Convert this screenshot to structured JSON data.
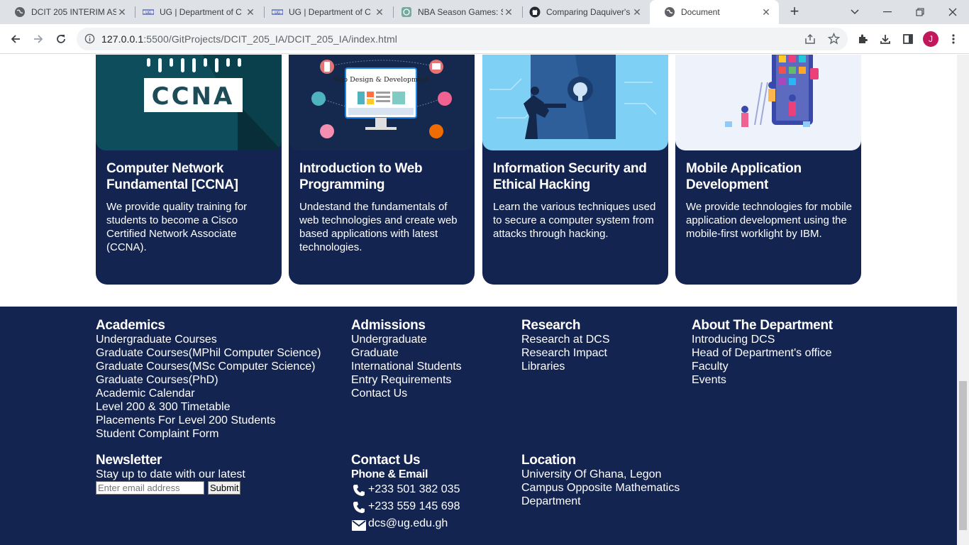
{
  "browser": {
    "tabs": [
      {
        "title": "DCIT 205 INTERIM AS",
        "icon": "globe-icon"
      },
      {
        "title": "UG | Department of C",
        "icon": "ug-logo-icon"
      },
      {
        "title": "UG | Department of C",
        "icon": "ug-logo-icon"
      },
      {
        "title": "NBA Season Games: S",
        "icon": "chatgpt-icon"
      },
      {
        "title": "Comparing Daquiver's",
        "icon": "github-icon"
      },
      {
        "title": "Document",
        "icon": "globe-icon"
      }
    ],
    "url_host": "127.0.0.1",
    "url_path": ":5500/GitProjects/DCIT_205_IA/DCIT_205_IA/index.html",
    "profile_initial": "J"
  },
  "cards": [
    {
      "title": "Computer Network Fundamental [CCNA]",
      "text": "We provide quality training for students to become a Cisco Certified Network Associate (CCNA).",
      "image_label": "CCNA"
    },
    {
      "title": "Introduction to Web Programming",
      "text": "Undestand the fundamentals of web technologies and create web based applications with latest technologies.",
      "image_label": "Web Design & Development"
    },
    {
      "title": "Information Security and Ethical Hacking",
      "text": "Learn the various techniques used to secure a computer system from attacks through hacking."
    },
    {
      "title": "Mobile Application Development",
      "text": "We provide technologies for mobile application development using the mobile-first worklight by IBM."
    }
  ],
  "footer": {
    "academics": {
      "heading": "Academics",
      "links": [
        "Undergraduate Courses",
        "Graduate Courses(MPhil Computer Science)",
        "Graduate Courses(MSc Computer Science)",
        "Graduate Courses(PhD)",
        "Academic Calendar",
        "Level 200 & 300 Timetable",
        "Placements For Level 200 Students",
        "Student Complaint Form"
      ]
    },
    "admissions": {
      "heading": "Admissions",
      "links": [
        "Undergraduate",
        "Graduate",
        "International Students",
        "Entry Requirements",
        "Contact Us"
      ]
    },
    "research": {
      "heading": "Research",
      "links": [
        "Research at DCS",
        "Research Impact",
        "Libraries"
      ]
    },
    "about": {
      "heading": "About The Department",
      "links": [
        "Introducing DCS",
        "Head of Department's office",
        "Faculty",
        "Events"
      ]
    },
    "newsletter": {
      "heading": "Newsletter",
      "text": "Stay up to date with our latest",
      "placeholder": "Enter email address",
      "submit": "Submit"
    },
    "contact": {
      "heading": "Contact Us",
      "subheading": "Phone & Email",
      "phone1": "+233 501 382 035",
      "phone2": "+233 559 145 698",
      "email": "dcs@ug.edu.gh"
    },
    "location": {
      "heading": "Location",
      "line1": "University Of Ghana, Legon",
      "line2": "Campus Opposite Mathematics",
      "line3": "Department"
    }
  },
  "colors": {
    "navy": "#142450",
    "chrome_bg": "#dee1e6"
  }
}
